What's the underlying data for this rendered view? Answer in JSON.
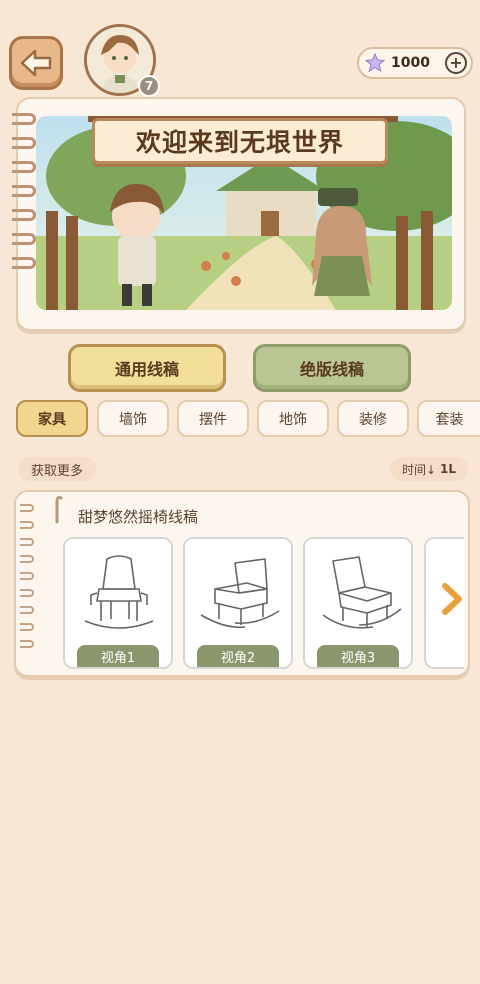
{
  "topbar": {
    "avatar_level": "7",
    "currency_amount": "1000",
    "plus_label": "+"
  },
  "banner": {
    "title": "欢迎来到无垠世界"
  },
  "main_tabs": {
    "general_label": "通用线稿",
    "limited_label": "绝版线稿"
  },
  "categories": [
    "家具",
    "墙饰",
    "摆件",
    "地饰",
    "装修",
    "套装"
  ],
  "filters": {
    "get_more": "获取更多",
    "sort_label": "时间↓",
    "sort_icon": "1L"
  },
  "item": {
    "title": "甜梦悠然摇椅线稿",
    "views": [
      "视角1",
      "视角2",
      "视角3"
    ]
  },
  "colors": {
    "background": "#f8e7d5",
    "active_tab": "#f2d58e",
    "limited_btn": "#b9c592",
    "view_label": "#8a966c"
  }
}
